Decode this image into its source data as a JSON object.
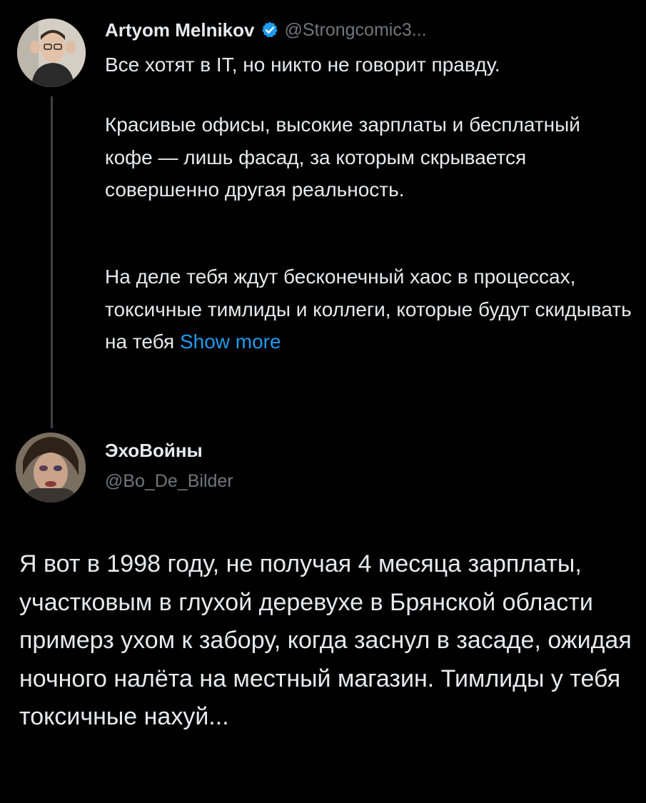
{
  "original_tweet": {
    "display_name": "Artyom Melnikov",
    "handle": "@Strongcomic3...",
    "paragraphs": [
      "Все хотят в IT, но никто не говорит правду.",
      "Красивые офисы, высокие зарплаты и бесплатный кофе — лишь фасад, за которым скрывается совершенно другая реальность.",
      "На деле тебя ждут бесконечный хаос в процессах, токсичные тимлиды и коллеги, которые будут скидывать на тебя"
    ],
    "show_more": "Show more",
    "verified_color": "#1d9bf0"
  },
  "reply": {
    "display_name": "ЭхоВойны",
    "handle": "@Bo_De_Bilder",
    "text": "Я вот в 1998 году, не получая 4 месяца зарплаты, участковым в глухой деревухе в Брянской области примерз ухом к забору, когда заснул в засаде, ожидая ночного налёта на местный магазин. Тимлиды у тебя токсичные нахуй..."
  }
}
